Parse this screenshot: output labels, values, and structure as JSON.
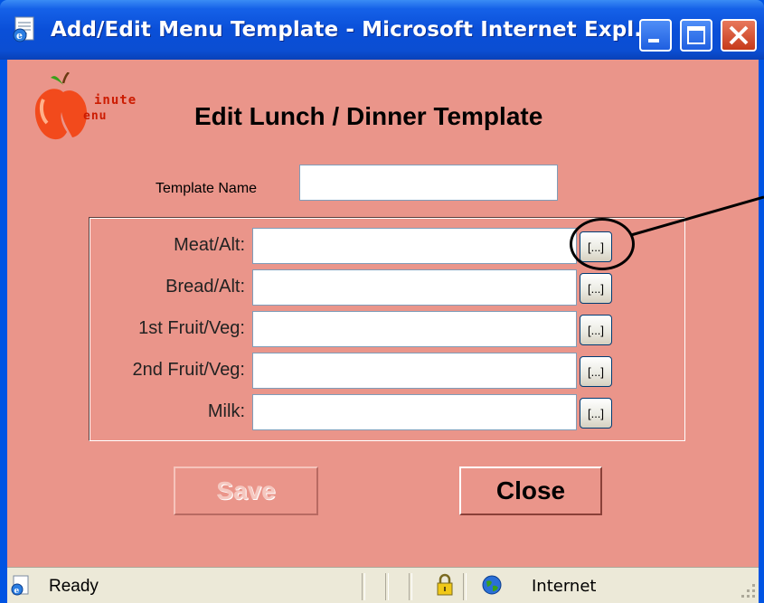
{
  "window": {
    "title": "Add/Edit Menu Template - Microsoft Internet Expl..."
  },
  "logo": {
    "text_top": "inute",
    "text_bottom": "enu"
  },
  "page": {
    "title": "Edit Lunch / Dinner Template"
  },
  "template_name": {
    "label": "Template Name",
    "value": ""
  },
  "rows": [
    {
      "label": "Meat/Alt:",
      "value": "",
      "button": "[...]"
    },
    {
      "label": "Bread/Alt:",
      "value": "",
      "button": "[...]"
    },
    {
      "label": "1st Fruit/Veg:",
      "value": "",
      "button": "[...]"
    },
    {
      "label": "2nd Fruit/Veg:",
      "value": "",
      "button": "[...]"
    },
    {
      "label": "Milk:",
      "value": "",
      "button": "[...]"
    }
  ],
  "buttons": {
    "save": "Save",
    "close": "Close"
  },
  "statusbar": {
    "status": "Ready",
    "zone": "Internet"
  },
  "colors": {
    "background": "#ea958a",
    "titlebar": "#0b4ed2",
    "logo_red": "#cc1b00"
  }
}
